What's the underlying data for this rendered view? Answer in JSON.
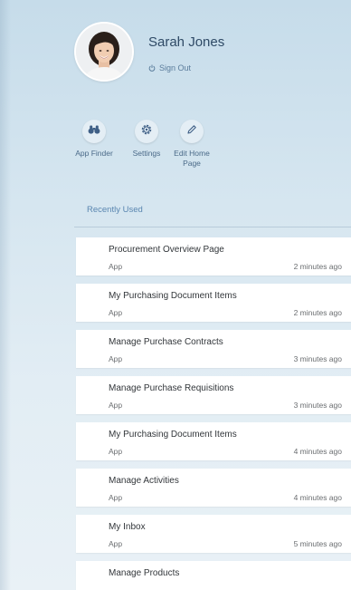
{
  "user": {
    "name": "Sarah Jones",
    "sign_out_label": "Sign Out"
  },
  "actions": [
    {
      "label": "App Finder",
      "icon": "binoculars-icon"
    },
    {
      "label": "Settings",
      "icon": "gear-icon"
    },
    {
      "label": "Edit Home Page",
      "icon": "pencil-icon"
    }
  ],
  "recent": {
    "title": "Recently Used",
    "items": [
      {
        "title": "Procurement Overview Page",
        "type": "App",
        "time": "2 minutes ago"
      },
      {
        "title": "My Purchasing Document Items",
        "type": "App",
        "time": "2 minutes ago"
      },
      {
        "title": "Manage Purchase Contracts",
        "type": "App",
        "time": "3 minutes ago"
      },
      {
        "title": "Manage Purchase Requisitions",
        "type": "App",
        "time": "3 minutes ago"
      },
      {
        "title": "My Purchasing Document Items",
        "type": "App",
        "time": "4 minutes ago"
      },
      {
        "title": "Manage Activities",
        "type": "App",
        "time": "4 minutes ago"
      },
      {
        "title": "My Inbox",
        "type": "App",
        "time": "5 minutes ago"
      },
      {
        "title": "Manage Products",
        "type": "",
        "time": ""
      }
    ]
  },
  "colors": {
    "accent": "#2f4a66",
    "link": "#5a86b0",
    "background_top": "#c6dcea",
    "card": "#ffffff"
  }
}
